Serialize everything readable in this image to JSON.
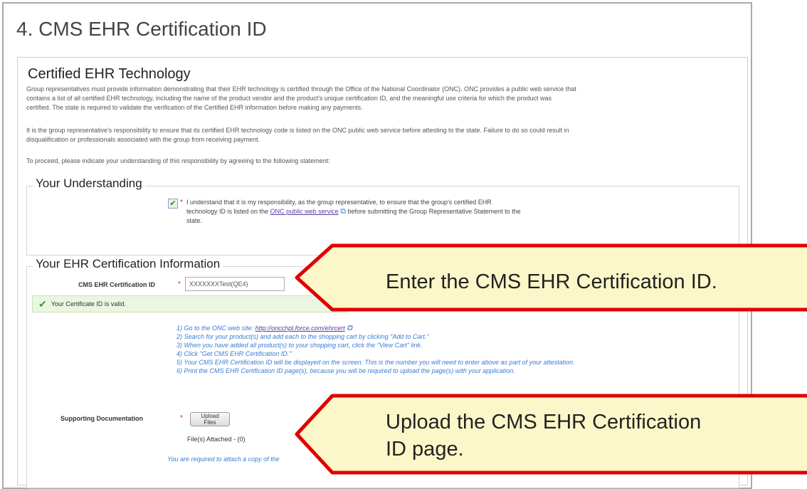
{
  "section_title": "4. CMS EHR Certification ID",
  "card": {
    "heading": "Certified EHR Technology",
    "paragraph1_line1": "Group representatives must provide information demonstrating that their EHR technology is certified through the Office of the National Coordinator (ONC). ONC provides a public web service that",
    "paragraph1_line2": "contains a list of all certified EHR technology, including the name of the product vendor and the product's unique certification ID, and the meaningful use criteria for which the product was",
    "paragraph1_line3": "certified. The state is required to validate the verification of the Certified EHR information before making any payments.",
    "paragraph2_line1": "It is the group representative's responsibility to ensure that its certified EHR technology code is listed on the ONC public web service before attesting to the state. Failure to do so could result in",
    "paragraph2_line2": "disqualification or professionals associated with the group from receiving payment.",
    "paragraph3": "To proceed, please indicate your understanding of this responsibility by agreeing to the following statement:"
  },
  "understanding": {
    "legend": "Your Understanding",
    "checkbox_checked": true,
    "required_mark": "*",
    "statement_line1": "I understand that it is my responsibility, as the group representative, to ensure that the group's certified EHR",
    "statement_line2_prefix": "technology ID is listed on the",
    "statement_link": "ONC public web service",
    "statement_line2_suffix": "before submitting the Group Representative Statement to the",
    "statement_line3": "state."
  },
  "ehr_info": {
    "legend": "Your EHR Certification Information",
    "cert_id_label": "CMS EHR Certification ID",
    "required_mark": "*",
    "cert_id_value": "XXXXXXXTest(QE4)",
    "valid_message": "Your Certificate ID is valid.",
    "steps": [
      "1) Go to the ONC web site:",
      "2) Search for your product(s) and add each to the shopping cart by clicking \"Add to Cart.\"",
      "3) When you have added all product(s) to your shopping cart, click the \"View Cart\" link.",
      "4) Click \"Get CMS EHR Certification ID.\"",
      "5) Your CMS EHR Certification ID will be displayed on the screen. This is the number you will need to enter above as part of your attestation.",
      "6) Print the CMS EHR Certification ID page(s), because you will be required to upload the page(s) with your application."
    ],
    "onc_url": "http://oncchpl.force.com/ehrcert",
    "supporting_label": "Supporting Documentation",
    "upload_button": "Upload Files",
    "files_attached": "File(s) Attached - (0)",
    "attach_note": "You are required to attach a copy of the"
  },
  "callouts": {
    "enter": "Enter the CMS EHR Certification ID.",
    "upload_line1": "Upload the CMS EHR Certification",
    "upload_line2": "ID page."
  },
  "colors": {
    "callout_fill": "#fbf7c8",
    "callout_border": "#e00000",
    "link": "#5a3aa6",
    "steps_text": "#3a7bd5",
    "valid_bg": "#eaf6e2"
  },
  "icons": {
    "checkbox": "check-mark",
    "external_link": "external-link-icon",
    "valid": "green-check-icon"
  }
}
